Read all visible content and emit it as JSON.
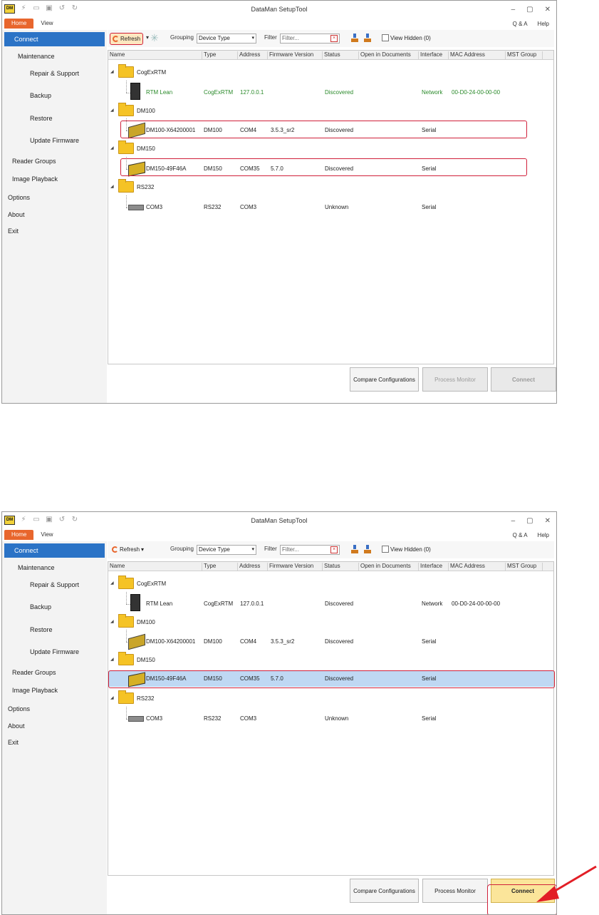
{
  "app": {
    "title": "DataMan SetupTool",
    "tabs": [
      "Home",
      "View"
    ],
    "help_links": [
      "Q & A",
      "Help"
    ]
  },
  "sidebar": {
    "items": [
      {
        "label": "Connect",
        "selected": true
      },
      {
        "label": "Maintenance"
      },
      {
        "label": "Repair & Support"
      },
      {
        "label": "Backup"
      },
      {
        "label": "Restore"
      },
      {
        "label": "Update Firmware"
      },
      {
        "label": "Reader Groups"
      },
      {
        "label": "Image Playback"
      },
      {
        "label": "Options"
      },
      {
        "label": "About"
      },
      {
        "label": "Exit"
      }
    ]
  },
  "toolbar": {
    "refresh_label": "Refresh",
    "grouping_label": "Grouping",
    "grouping_value": "Device Type",
    "filter_label": "Filter",
    "filter_placeholder": "Filter...",
    "view_hidden_label": "View Hidden (0)"
  },
  "columns": [
    "Name",
    "Type",
    "Address",
    "Firmware Version",
    "Status",
    "Open in Documents",
    "Interface",
    "MAC Address",
    "MST Group"
  ],
  "groups": [
    {
      "name": "CogExRTM",
      "devices": [
        {
          "name": "RTM Lean",
          "type": "CogExRTM",
          "address": "127.0.0.1",
          "firmware": "",
          "status": "Discovered",
          "interface": "Network",
          "mac": "00-D0-24-00-00-00"
        }
      ]
    },
    {
      "name": "DM100",
      "devices": [
        {
          "name": "DM100-X64200001",
          "type": "DM100",
          "address": "COM4",
          "firmware": "3.5.3_sr2",
          "status": "Discovered",
          "interface": "Serial",
          "mac": ""
        }
      ]
    },
    {
      "name": "DM150",
      "devices": [
        {
          "name": "DM150-49F46A",
          "type": "DM150",
          "address": "COM35",
          "firmware": "5.7.0",
          "status": "Discovered",
          "interface": "Serial",
          "mac": ""
        }
      ]
    },
    {
      "name": "RS232",
      "devices": [
        {
          "name": "COM3",
          "type": "RS232",
          "address": "COM3",
          "firmware": "",
          "status": "Unknown",
          "interface": "Serial",
          "mac": ""
        }
      ]
    }
  ],
  "footer": {
    "compare_label": "Compare Configurations",
    "process_monitor_label": "Process Monitor",
    "connect_label": "Connect"
  },
  "colors": {
    "accent": "#e8662d",
    "selection": "#2b73c6",
    "highlight": "#d0203a",
    "connect_active": "#fbe59a"
  }
}
